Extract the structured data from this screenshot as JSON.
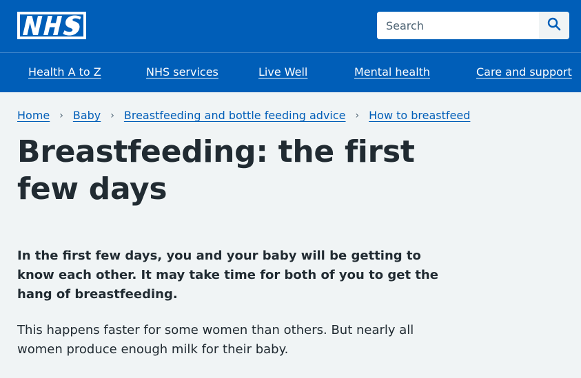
{
  "header": {
    "logo_text": "NHS",
    "brand_color": "#005eb8",
    "search": {
      "placeholder": "Search",
      "value": "",
      "button_icon": "search-icon"
    }
  },
  "nav": {
    "items": [
      {
        "label": "Health A to Z"
      },
      {
        "label": "NHS services"
      },
      {
        "label": "Live Well"
      },
      {
        "label": "Mental health"
      },
      {
        "label": "Care and support"
      }
    ]
  },
  "breadcrumb": {
    "items": [
      {
        "label": "Home"
      },
      {
        "label": "Baby"
      },
      {
        "label": "Breastfeeding and bottle feeding advice"
      },
      {
        "label": "How to breastfeed"
      }
    ],
    "separator_icon": "chevron-right-icon"
  },
  "page": {
    "title": "Breastfeeding: the first few days",
    "lede": "In the first few days, you and your baby will be getting to know each other. It may take time for both of you to get the hang of breastfeeding.",
    "body": "This happens faster for some women than others. But nearly all women produce enough milk for their baby."
  }
}
